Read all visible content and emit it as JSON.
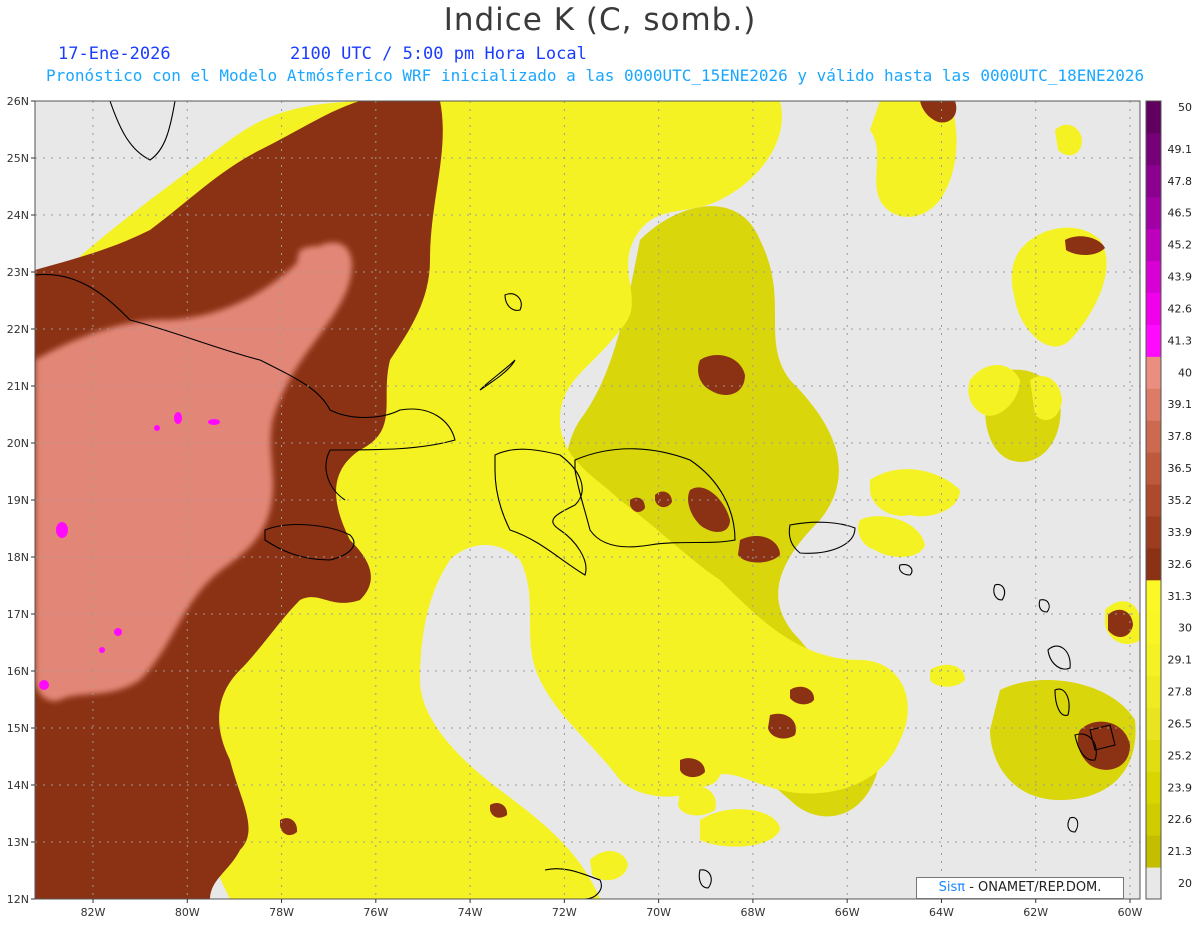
{
  "header": {
    "title": "Indice K (C, somb.)",
    "date": "17-Ene-2026",
    "time": "2100 UTC / 5:00 pm Hora Local",
    "subtitle": "Pronóstico con el Modelo Atmósferico WRF inicializado a las 0000UTC_15ENE2026 y válido hasta las  0000UTC_18ENE2026"
  },
  "axes": {
    "lat_labels": [
      "26N",
      "25N",
      "24N",
      "23N",
      "22N",
      "21N",
      "20N",
      "19N",
      "18N",
      "17N",
      "16N",
      "15N",
      "14N",
      "13N",
      "12N"
    ],
    "lon_labels": [
      "82W",
      "80W",
      "78W",
      "76W",
      "74W",
      "72W",
      "70W",
      "68W",
      "66W",
      "64W",
      "62W",
      "60W"
    ]
  },
  "colorbar": {
    "labels": [
      "50",
      "49.1",
      "47.8",
      "46.5",
      "45.2",
      "43.9",
      "42.6",
      "41.3",
      "40",
      "39.1",
      "37.8",
      "36.5",
      "35.2",
      "33.9",
      "32.6",
      "31.3",
      "30",
      "29.1",
      "27.8",
      "26.5",
      "25.2",
      "23.9",
      "22.6",
      "21.3",
      "20"
    ],
    "colors": [
      "#e8e8e8",
      "#c3bf00",
      "#cfcc00",
      "#d8d500",
      "#e0dd10",
      "#e8e520",
      "#eeeb20",
      "#f5f224",
      "#f9f625",
      "#fbf826",
      "#8c3214",
      "#9c3d20",
      "#ad4a2c",
      "#bd5a3c",
      "#cc6a50",
      "#dc7c66",
      "#ea8e80",
      "#ff0aff",
      "#f200ec",
      "#d800d4",
      "#bd00bc",
      "#a000a4",
      "#8c008f",
      "#760078",
      "#62005f"
    ]
  },
  "credit": {
    "logo": "Sisπ",
    "text": " - ONAMET/REP.DOM."
  },
  "palette": {
    "background": "#e8e8e8",
    "yellow": "#f5f224",
    "olive": "#d8d500",
    "brown": "#8c3214",
    "salmon": "#ea8e80",
    "magenta": "#ff0aff",
    "coast": "#000000",
    "grid": "#9a9a9a"
  }
}
